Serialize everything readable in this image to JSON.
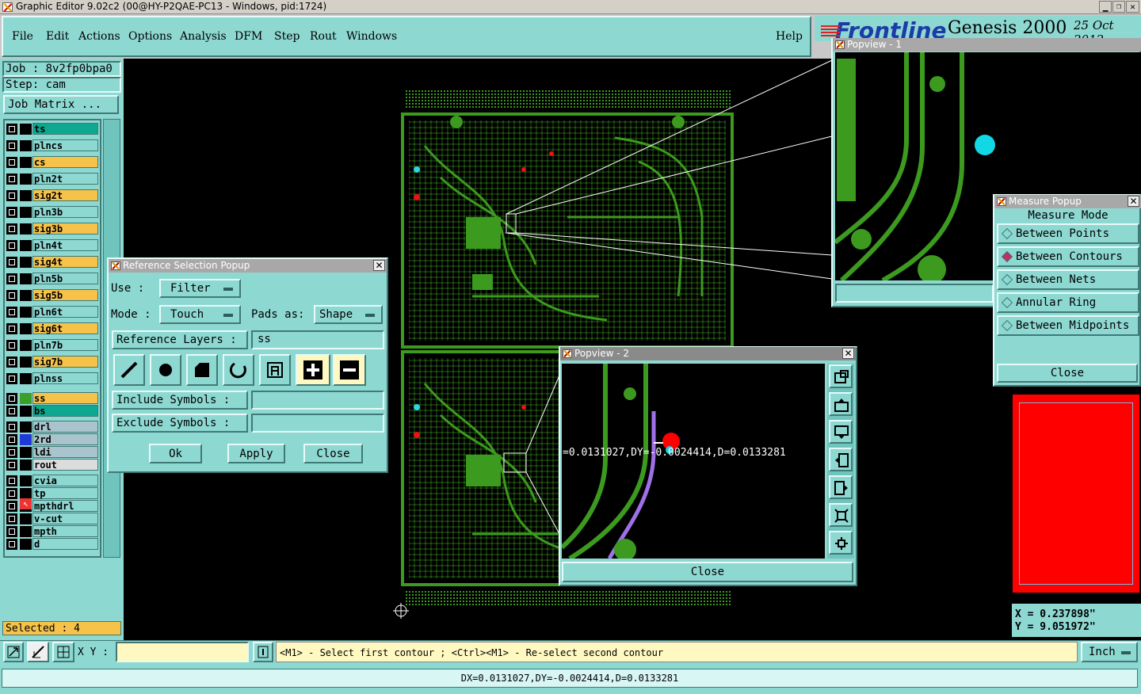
{
  "window": {
    "title": "Graphic Editor 9.02c2 (00@HY-P2QAE-PC13 - Windows, pid:1724)"
  },
  "menu": {
    "items": [
      "File",
      "Edit",
      "Actions",
      "Options",
      "Analysis",
      "DFM",
      "Step",
      "Rout",
      "Windows"
    ],
    "help": "Help"
  },
  "brand": {
    "logo": "Frontline",
    "product": "Genesis 2000",
    "date": "25 Oct 2012"
  },
  "job": {
    "job_line": "Job : 8v2fp0bpa0",
    "step_line": "Step: cam",
    "matrix_button": "Job Matrix ..."
  },
  "layers": [
    {
      "name": "ts",
      "color": "#0da88f"
    },
    {
      "name": "plncs",
      "color": "#8ed8d2"
    },
    {
      "name": "cs",
      "color": "#f6c24a"
    },
    {
      "name": "pln2t",
      "color": "#8ed8d2"
    },
    {
      "name": "sig2t",
      "color": "#f6c24a"
    },
    {
      "name": "pln3b",
      "color": "#8ed8d2"
    },
    {
      "name": "sig3b",
      "color": "#f6c24a"
    },
    {
      "name": "pln4t",
      "color": "#8ed8d2"
    },
    {
      "name": "sig4t",
      "color": "#f6c24a"
    },
    {
      "name": "pln5b",
      "color": "#8ed8d2"
    },
    {
      "name": "sig5b",
      "color": "#f6c24a"
    },
    {
      "name": "pln6t",
      "color": "#8ed8d2"
    },
    {
      "name": "sig6t",
      "color": "#f6c24a"
    },
    {
      "name": "pln7b",
      "color": "#8ed8d2"
    },
    {
      "name": "sig7b",
      "color": "#f6c24a"
    },
    {
      "name": "plnss",
      "color": "#8ed8d2"
    },
    {
      "name": "ss",
      "color": "#f6c24a",
      "swatch": "#3aa02a"
    },
    {
      "name": "bs",
      "color": "#0da88f"
    },
    {
      "name": "drl",
      "color": "#a9c4cc"
    },
    {
      "name": "2rd",
      "color": "#a9c4cc",
      "swatch": "#1f3ad8"
    },
    {
      "name": "ldi",
      "color": "#a9c4cc"
    },
    {
      "name": "rout",
      "color": "#dcdcdc"
    },
    {
      "name": "cvia",
      "color": "#8ed8d2"
    },
    {
      "name": "tp",
      "color": "#8ed8d2"
    },
    {
      "name": "mpthdrl",
      "color": "#8ed8d2"
    },
    {
      "name": "v-cut",
      "color": "#8ed8d2"
    },
    {
      "name": "mpth",
      "color": "#8ed8d2"
    },
    {
      "name": "d",
      "color": "#8ed8d2"
    }
  ],
  "selected": "Selected : 4",
  "refpopup": {
    "title": "Reference Selection Popup",
    "use_label": "Use   :",
    "use_value": "Filter",
    "mode_label": "Mode  :",
    "mode_value": "Touch",
    "pads_label": "Pads as:",
    "pads_value": "Shape",
    "ref_layers_label": "Reference Layers :",
    "ref_layers_value": "ss",
    "include_label": "Include Symbols :",
    "include_value": "",
    "exclude_label": "Exclude Symbols :",
    "exclude_value": "",
    "ok": "Ok",
    "apply": "Apply",
    "close": "Close"
  },
  "popview1": {
    "title": "Popview - 1"
  },
  "popview2": {
    "title": "Popview - 2",
    "measure_text": "=0.0131027,DY=-0.0024414,D=0.0133281",
    "close": "Close"
  },
  "measure": {
    "title": "Measure Popup",
    "heading": "Measure Mode",
    "options": [
      "Between Points",
      "Between Contours",
      "Between Nets",
      "Annular Ring",
      "Between Midpoints"
    ],
    "selected_index": 1,
    "close": "Close"
  },
  "coords": {
    "x": "X = 0.237898\"",
    "y": "Y = 9.051972\""
  },
  "bottom": {
    "xy_label": "X Y :",
    "xy_value": "",
    "hint": "<M1> - Select first contour ; <Ctrl><M1> - Re-select second contour",
    "units": "Inch",
    "status": "DX=0.0131027,DY=-0.0024414,D=0.0133281"
  },
  "colors": {
    "panel": "#8ed8d2",
    "trace": "#3c9a1e",
    "canvas": "#000000",
    "highlight_red": "#ff0000"
  }
}
